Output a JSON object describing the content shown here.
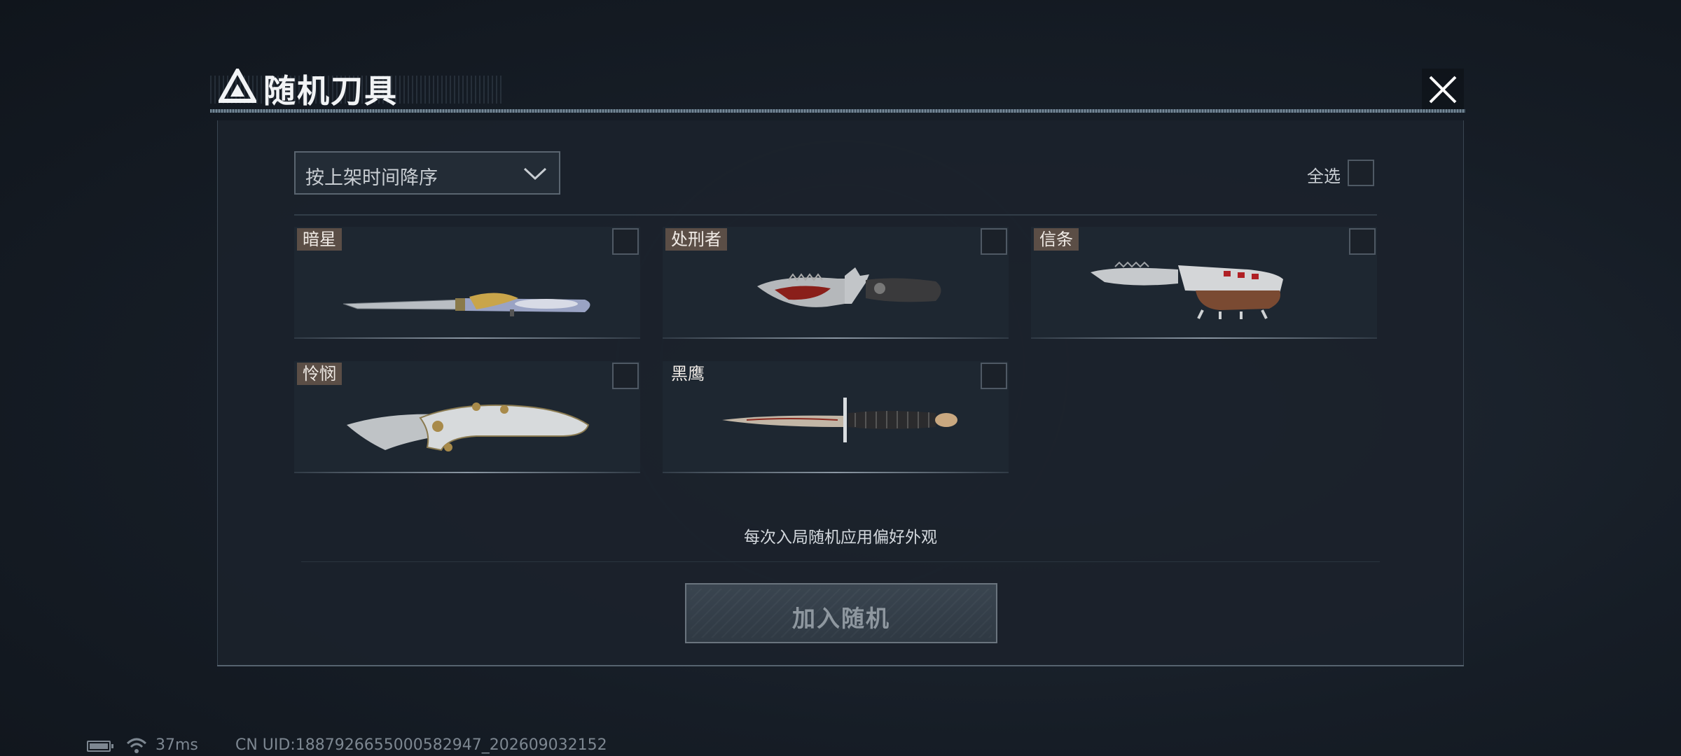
{
  "dialog": {
    "title": "随机刀具",
    "close_icon": "close-icon",
    "logo_icon": "triangle-logo-icon"
  },
  "toolbar": {
    "sort_value": "按上架时间降序",
    "sort_icon": "chevron-down-icon",
    "select_all_label": "全选",
    "select_all_checked": false
  },
  "knives": [
    {
      "name": "暗星",
      "checked": false,
      "icon": "dark-star-knife-icon"
    },
    {
      "name": "处刑者",
      "checked": false,
      "icon": "executioner-knife-icon"
    },
    {
      "name": "信条",
      "checked": false,
      "icon": "creed-knuckle-knife-icon"
    },
    {
      "name": "怜悯",
      "checked": false,
      "icon": "mercy-folding-knife-icon"
    },
    {
      "name": "黑鹰",
      "checked": false,
      "icon": "black-hawk-dagger-icon"
    }
  ],
  "hint": "每次入局随机应用偏好外观",
  "join_button_label": "加入随机",
  "status": {
    "ping": "37ms",
    "uid": "CN UID:1887926655000582947_202609032152",
    "battery_icon": "battery-icon",
    "wifi_icon": "wifi-icon"
  },
  "colors": {
    "background": "#161d26",
    "panel": "#1b222b",
    "tag": "#5b4e46",
    "button": "#3a4550"
  }
}
